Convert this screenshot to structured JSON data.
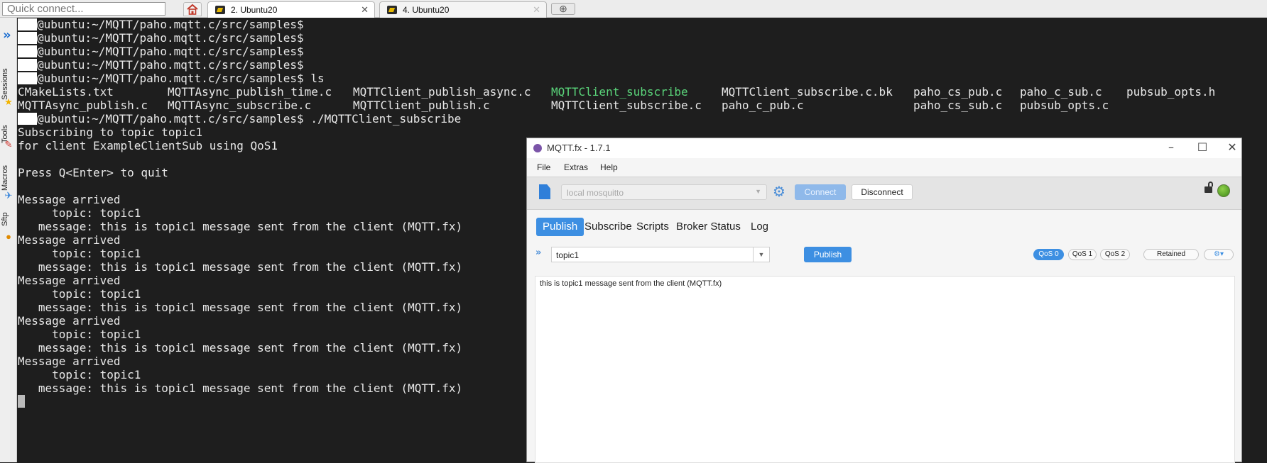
{
  "topbar": {
    "quick_connect_placeholder": "Quick connect...",
    "tabs": [
      {
        "label": "2. Ubuntu20",
        "active": true
      },
      {
        "label": "4. Ubuntu20",
        "active": false
      }
    ]
  },
  "sidebar": {
    "items": [
      "Sessions",
      "Tools",
      "Macros",
      "Sftp"
    ]
  },
  "terminal": {
    "prompt_path": "@ubuntu:~/MQTT/paho.mqtt.c/src/samples$",
    "lines": [
      "@ubuntu:~/MQTT/paho.mqtt.c/src/samples$",
      "@ubuntu:~/MQTT/paho.mqtt.c/src/samples$",
      "@ubuntu:~/MQTT/paho.mqtt.c/src/samples$",
      "@ubuntu:~/MQTT/paho.mqtt.c/src/samples$",
      "@ubuntu:~/MQTT/paho.mqtt.c/src/samples$ ls"
    ],
    "ls_row1": [
      "CMakeLists.txt",
      "MQTTAsync_publish_time.c",
      "MQTTClient_publish_async.c",
      "MQTTClient_subscribe",
      "MQTTClient_subscribe.c.bk",
      "paho_cs_pub.c",
      "paho_c_sub.c",
      "pubsub_opts.h"
    ],
    "ls_row2": [
      "MQTTAsync_publish.c",
      "MQTTAsync_subscribe.c",
      "MQTTClient_publish.c",
      "MQTTClient_subscribe.c",
      "paho_c_pub.c",
      "paho_cs_sub.c",
      "pubsub_opts.c"
    ],
    "run_cmd": "@ubuntu:~/MQTT/paho.mqtt.c/src/samples$ ./MQTTClient_subscribe",
    "output": [
      "Subscribing to topic topic1",
      "for client ExampleClientSub using QoS1",
      "",
      "Press Q<Enter> to quit",
      "",
      "Message arrived",
      "     topic: topic1",
      "   message: this is topic1 message sent from the client (MQTT.fx)",
      "Message arrived",
      "     topic: topic1",
      "   message: this is topic1 message sent from the client (MQTT.fx)",
      "Message arrived",
      "     topic: topic1",
      "   message: this is topic1 message sent from the client (MQTT.fx)",
      "Message arrived",
      "     topic: topic1",
      "   message: this is topic1 message sent from the client (MQTT.fx)",
      "Message arrived",
      "     topic: topic1",
      "   message: this is topic1 message sent from the client (MQTT.fx)"
    ]
  },
  "mqttfx": {
    "title": "MQTT.fx - 1.7.1",
    "menu": [
      "File",
      "Extras",
      "Help"
    ],
    "profile": "local mosquitto",
    "connect_label": "Connect",
    "disconnect_label": "Disconnect",
    "tabs": [
      "Publish",
      "Subscribe",
      "Scripts",
      "Broker Status",
      "Log"
    ],
    "topic": "topic1",
    "publish_label": "Publish",
    "qos": [
      "QoS 0",
      "QoS 1",
      "QoS 2"
    ],
    "retained_label": "Retained",
    "payload": "this is topic1 message sent from the client (MQTT.fx)"
  }
}
